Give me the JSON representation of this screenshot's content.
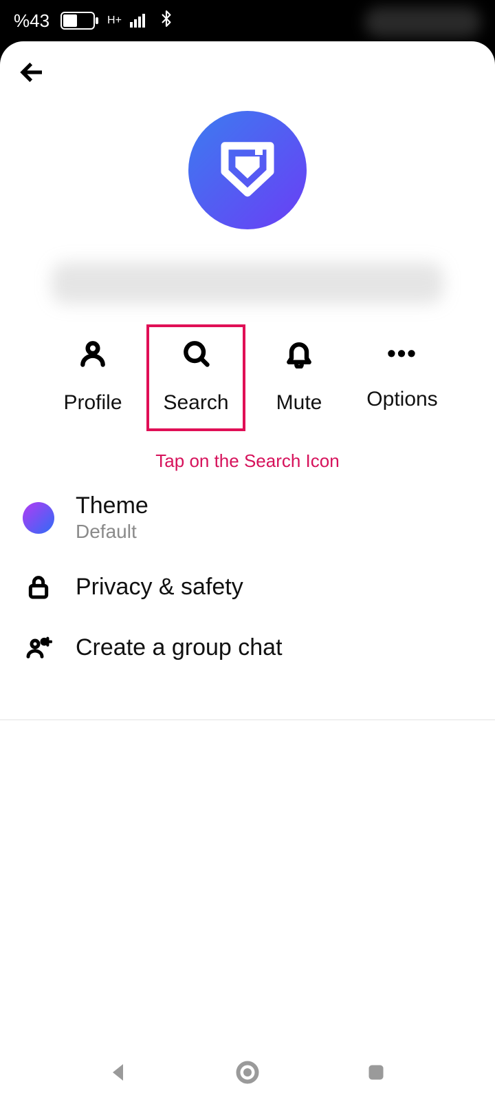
{
  "statusbar": {
    "battery_pct": "%43",
    "network_label": "H+"
  },
  "actions": {
    "profile": "Profile",
    "search": "Search",
    "mute": "Mute",
    "options": "Options"
  },
  "annotation": "Tap on the Search Icon",
  "settings": {
    "theme_label": "Theme",
    "theme_value": "Default",
    "privacy_label": "Privacy & safety",
    "group_label": "Create a group chat"
  }
}
